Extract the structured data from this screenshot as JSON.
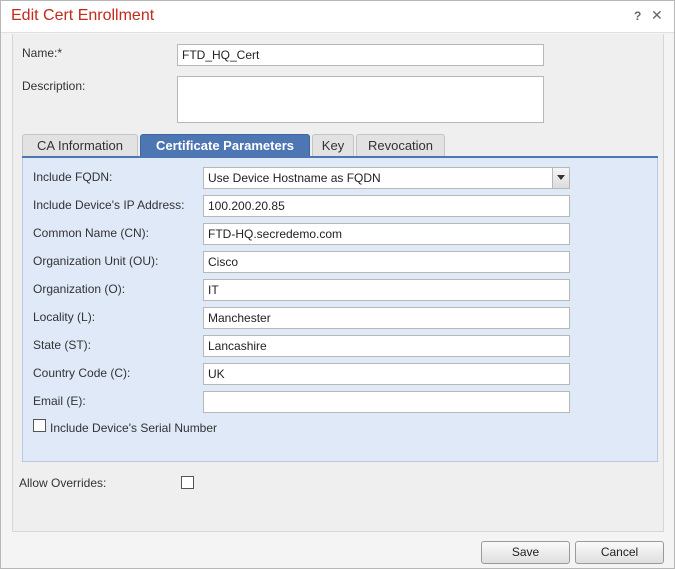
{
  "dialog": {
    "title": "Edit Cert Enrollment",
    "help_icon": "?",
    "close_icon": "✕"
  },
  "form": {
    "name_label": "Name:*",
    "name_value": "FTD_HQ_Cert",
    "description_label": "Description:",
    "description_value": ""
  },
  "tabs": [
    {
      "label": "CA Information",
      "active": false
    },
    {
      "label": "Certificate Parameters",
      "active": true
    },
    {
      "label": "Key",
      "active": false
    },
    {
      "label": "Revocation",
      "active": false
    }
  ],
  "cert_params": {
    "fqdn_label": "Include FQDN:",
    "fqdn_value": "Use Device Hostname as FQDN",
    "ip_label": "Include Device's IP Address:",
    "ip_value": "100.200.20.85",
    "cn_label": "Common Name (CN):",
    "cn_value": "FTD-HQ.secredemo.com",
    "ou_label": "Organization Unit (OU):",
    "ou_value": "Cisco",
    "o_label": "Organization (O):",
    "o_value": "IT",
    "l_label": "Locality (L):",
    "l_value": "Manchester",
    "st_label": "State (ST):",
    "st_value": "Lancashire",
    "c_label": "Country Code (C):",
    "c_value": "UK",
    "email_label": "Email (E):",
    "email_value": "",
    "serial_label": "Include Device's Serial Number",
    "serial_checked": false
  },
  "overrides": {
    "label": "Allow Overrides:",
    "checked": false
  },
  "footer": {
    "save_label": "Save",
    "cancel_label": "Cancel"
  },
  "colors": {
    "title": "#c4291c",
    "tab_active": "#4e76b3",
    "panel_bg": "#dfe9f8"
  }
}
